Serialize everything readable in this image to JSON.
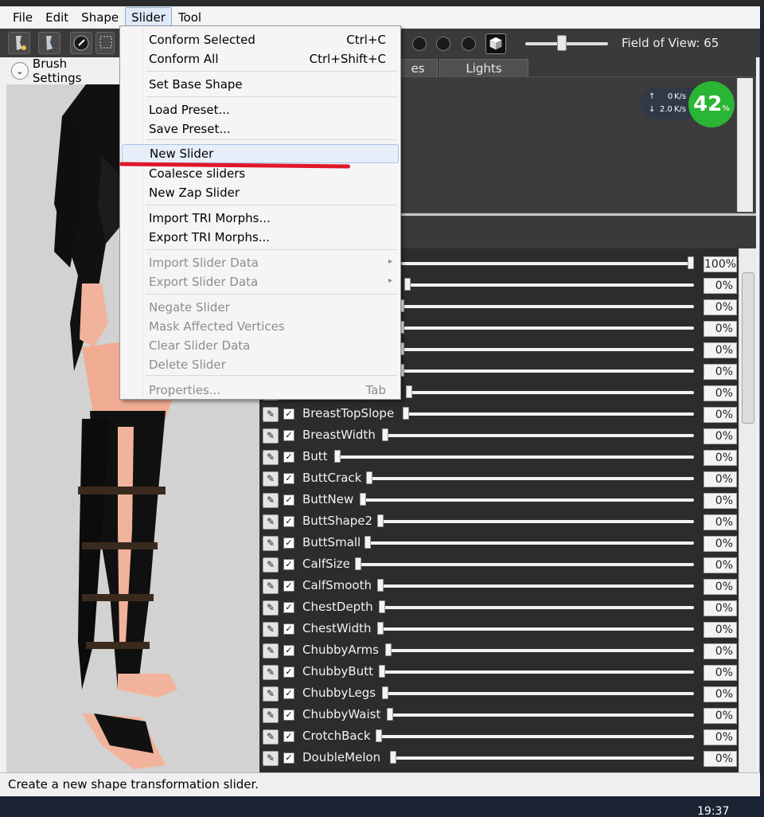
{
  "menubar": [
    "File",
    "Edit",
    "Shape",
    "Slider",
    "Tool"
  ],
  "toolbar": {
    "fov_label": "Field of View: 65"
  },
  "left_panel": {
    "brush_settings_label": "Brush Settings"
  },
  "tabs": [
    "es",
    "Lights"
  ],
  "speed": {
    "up": "0",
    "down": "2.0",
    "unit": "K/s",
    "percent": "42",
    "pct_sign": "%"
  },
  "slider_menu": {
    "items": [
      {
        "label": "Conform Selected",
        "shortcut": "Ctrl+C",
        "enabled": true
      },
      {
        "label": "Conform All",
        "shortcut": "Ctrl+Shift+C",
        "enabled": true
      },
      {
        "label": "Set Base Shape",
        "shortcut": "",
        "enabled": true
      },
      {
        "label": "Load Preset...",
        "shortcut": "",
        "enabled": true
      },
      {
        "label": "Save Preset...",
        "shortcut": "",
        "enabled": true
      },
      {
        "label": "New Slider",
        "shortcut": "",
        "enabled": true
      },
      {
        "label": "Coalesce sliders",
        "shortcut": "",
        "enabled": true
      },
      {
        "label": "New Zap Slider",
        "shortcut": "",
        "enabled": true
      },
      {
        "label": "Import TRI Morphs...",
        "shortcut": "",
        "enabled": true
      },
      {
        "label": "Export TRI Morphs...",
        "shortcut": "",
        "enabled": true
      },
      {
        "label": "Import Slider Data",
        "shortcut": "",
        "enabled": false
      },
      {
        "label": "Export Slider Data",
        "shortcut": "",
        "enabled": false
      },
      {
        "label": "Negate Slider",
        "shortcut": "",
        "enabled": false
      },
      {
        "label": "Mask Affected Vertices",
        "shortcut": "",
        "enabled": false
      },
      {
        "label": "Clear Slider Data",
        "shortcut": "",
        "enabled": false
      },
      {
        "label": "Delete Slider",
        "shortcut": "",
        "enabled": false
      },
      {
        "label": "Properties...",
        "shortcut": "Tab",
        "enabled": false
      }
    ]
  },
  "sliders": [
    {
      "name": "",
      "value": "100%",
      "level": 1.0
    },
    {
      "name": "",
      "value": "0%",
      "level": 0.0
    },
    {
      "name": "",
      "value": "0%",
      "level": 0.0
    },
    {
      "name": "",
      "value": "0%",
      "level": 0.0
    },
    {
      "name": "",
      "value": "0%",
      "level": 0.0
    },
    {
      "name": "",
      "value": "0%",
      "level": 0.0
    },
    {
      "name": "",
      "value": "0%",
      "level": 0.0
    },
    {
      "name": "BreastTopSlope",
      "value": "0%",
      "level": 0.0
    },
    {
      "name": "BreastWidth",
      "value": "0%",
      "level": 0.0
    },
    {
      "name": "Butt",
      "value": "0%",
      "level": 0.0
    },
    {
      "name": "ButtCrack",
      "value": "0%",
      "level": 0.0
    },
    {
      "name": "ButtNew",
      "value": "0%",
      "level": 0.0
    },
    {
      "name": "ButtShape2",
      "value": "0%",
      "level": 0.0
    },
    {
      "name": "ButtSmall",
      "value": "0%",
      "level": 0.0
    },
    {
      "name": "CalfSize",
      "value": "0%",
      "level": 0.0
    },
    {
      "name": "CalfSmooth",
      "value": "0%",
      "level": 0.0
    },
    {
      "name": "ChestDepth",
      "value": "0%",
      "level": 0.0
    },
    {
      "name": "ChestWidth",
      "value": "0%",
      "level": 0.0
    },
    {
      "name": "ChubbyArms",
      "value": "0%",
      "level": 0.0
    },
    {
      "name": "ChubbyButt",
      "value": "0%",
      "level": 0.0
    },
    {
      "name": "ChubbyLegs",
      "value": "0%",
      "level": 0.0
    },
    {
      "name": "ChubbyWaist",
      "value": "0%",
      "level": 0.0
    },
    {
      "name": "CrotchBack",
      "value": "0%",
      "level": 0.0
    },
    {
      "name": "DoubleMelon",
      "value": "0%",
      "level": 0.0
    }
  ],
  "status": {
    "text": "Create a new shape transformation slider."
  },
  "taskbar": {
    "clock": "19:37"
  },
  "colors": {
    "highlight_underline": "#e0172a",
    "progress_green": "#2ab534"
  }
}
